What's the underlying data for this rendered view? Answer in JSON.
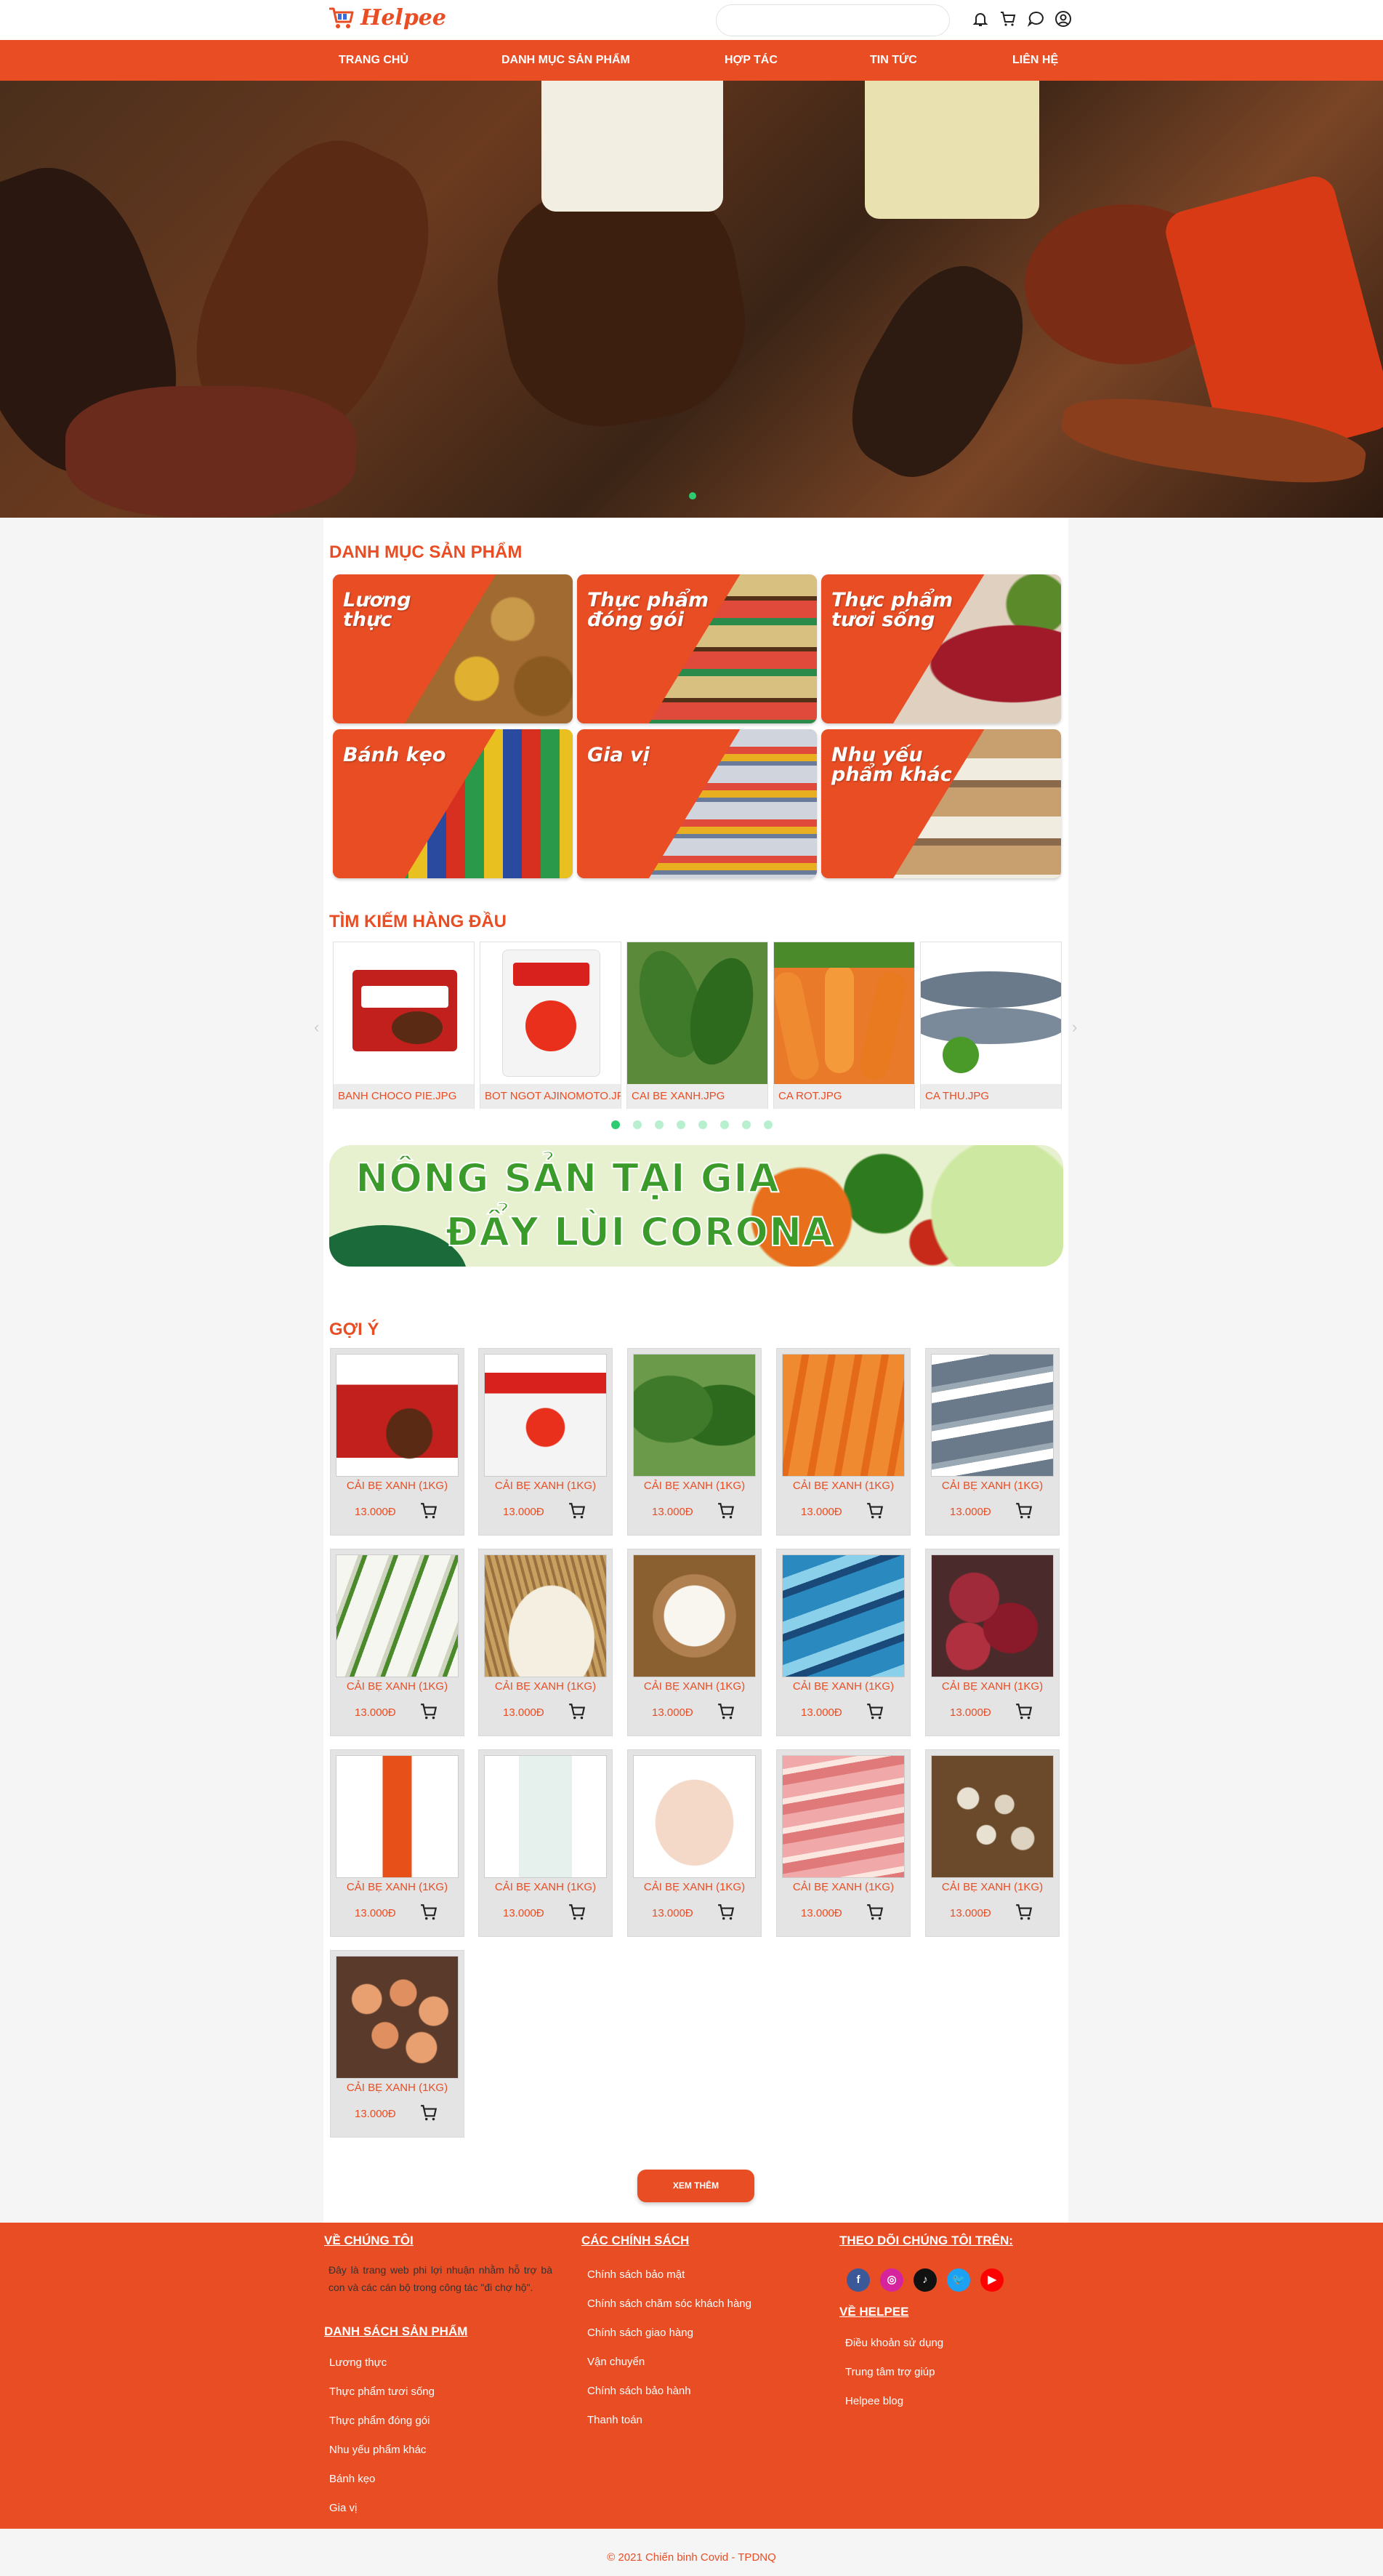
{
  "brand": {
    "name": "Helpee",
    "color": "#e84d24"
  },
  "header": {
    "icons": [
      "bell-icon",
      "cart-icon",
      "chat-icon",
      "user-icon"
    ]
  },
  "nav": {
    "items": [
      {
        "label": "TRANG CHỦ"
      },
      {
        "label": "DANH MỤC SẢN PHẨM"
      },
      {
        "label": "HỢP TÁC"
      },
      {
        "label": "TIN TỨC"
      },
      {
        "label": "LIÊN HỆ"
      }
    ]
  },
  "hero": {
    "slide_count": 1,
    "active_slide": 0
  },
  "categories": {
    "title": "DANH MỤC SẢN PHẨM",
    "items": [
      {
        "label": "Lương thực"
      },
      {
        "label": "Thực phẩm đóng gói"
      },
      {
        "label": "Thực phẩm tươi sống"
      },
      {
        "label": "Bánh kẹo"
      },
      {
        "label": "Gia vị"
      },
      {
        "label": "Nhu yếu phẩm khác"
      }
    ]
  },
  "top_search": {
    "title": "TÌM KIẾM HÀNG ĐẦU",
    "items": [
      {
        "caption": "BANH CHOCO PIE.JPG",
        "image": "choco-pie"
      },
      {
        "caption": "BOT NGOT AJINOMOTO.JPG",
        "image": "ajinomoto"
      },
      {
        "caption": "CAI BE XANH.JPG",
        "image": "mustard-greens"
      },
      {
        "caption": "CA ROT.JPG",
        "image": "carrot"
      },
      {
        "caption": "CA THU.JPG",
        "image": "mackerel"
      }
    ],
    "page_count": 8,
    "active_page": 0
  },
  "promo_banner": {
    "line1": "NÔNG SẢN TẠI GIA",
    "line2": "ĐẨY LÙI CORONA"
  },
  "suggest": {
    "title": "GỢI Ý",
    "items": [
      {
        "name": "CẢI BẸ XANH (1KG)",
        "price": "13.000Đ",
        "image": "choco-pie"
      },
      {
        "name": "CẢI BẸ XANH (1KG)",
        "price": "13.000Đ",
        "image": "ajinomoto"
      },
      {
        "name": "CẢI BẸ XANH (1KG)",
        "price": "13.000Đ",
        "image": "mustard-greens"
      },
      {
        "name": "CẢI BẸ XANH (1KG)",
        "price": "13.000Đ",
        "image": "carrot"
      },
      {
        "name": "CẢI BẸ XANH (1KG)",
        "price": "13.000Đ",
        "image": "mackerel"
      },
      {
        "name": "CẢI BẸ XANH (1KG)",
        "price": "13.000Đ",
        "image": "radish"
      },
      {
        "name": "CẢI BẸ XANH (1KG)",
        "price": "13.000Đ",
        "image": "rice-grain"
      },
      {
        "name": "CẢI BẸ XANH (1KG)",
        "price": "13.000Đ",
        "image": "rice-basket"
      },
      {
        "name": "CẢI BẸ XANH (1KG)",
        "price": "13.000Đ",
        "image": "masks"
      },
      {
        "name": "CẢI BẸ XANH (1KG)",
        "price": "13.000Đ",
        "image": "sweet-potato"
      },
      {
        "name": "CẢI BẸ XANH (1KG)",
        "price": "13.000Đ",
        "image": "fish-sauce"
      },
      {
        "name": "CẢI BẸ XANH (1KG)",
        "price": "13.000Đ",
        "image": "hand-sanitizer"
      },
      {
        "name": "CẢI BẸ XANH (1KG)",
        "price": "13.000Đ",
        "image": "chicken"
      },
      {
        "name": "CẢI BẸ XANH (1KG)",
        "price": "13.000Đ",
        "image": "pork-belly"
      },
      {
        "name": "CẢI BẸ XANH (1KG)",
        "price": "13.000Đ",
        "image": "quail-eggs"
      },
      {
        "name": "CẢI BẸ XANH (1KG)",
        "price": "13.000Đ",
        "image": "eggs"
      }
    ],
    "more_label": "XEM THÊM"
  },
  "footer": {
    "about": {
      "title": "VỀ CHÚNG TÔI",
      "text": "Đây là trang web phi lợi nhuận nhằm hỗ trợ bà con và các cán bộ trong công tác \"đi chợ hộ\"."
    },
    "product_list": {
      "title": "DANH SÁCH SẢN PHẨM",
      "links": [
        "Lương thực",
        "Thực phẩm tươi sống",
        "Thực phẩm đóng gói",
        "Nhu yếu phẩm khác",
        "Bánh kẹo",
        "Gia vị"
      ]
    },
    "policies": {
      "title": "CÁC CHÍNH SÁCH",
      "links": [
        "Chính sách bảo mật",
        "Chính sách chăm sóc khách hàng",
        "Chính sách giao hàng",
        "Vận chuyển",
        "Chính sách bảo hành",
        "Thanh toán"
      ]
    },
    "follow": {
      "title": "THEO DÕI CHÚNG TÔI TRÊN:",
      "socials": [
        {
          "name": "facebook-icon",
          "glyph": "f",
          "color": "#3b5998"
        },
        {
          "name": "instagram-icon",
          "glyph": "◎",
          "color": "#d6249f"
        },
        {
          "name": "tiktok-icon",
          "glyph": "♪",
          "color": "#111111"
        },
        {
          "name": "twitter-icon",
          "glyph": "🐦",
          "color": "#1da1f2"
        },
        {
          "name": "youtube-icon",
          "glyph": "▶",
          "color": "#ff0000"
        }
      ]
    },
    "about_helpee": {
      "title": "VỀ HELPEE",
      "links": [
        "Điều khoản sử dụng",
        "Trung tâm trợ giúp",
        "Helpee blog"
      ]
    }
  },
  "copyright": "© 2021 Chiến binh Covid - TPDNQ"
}
